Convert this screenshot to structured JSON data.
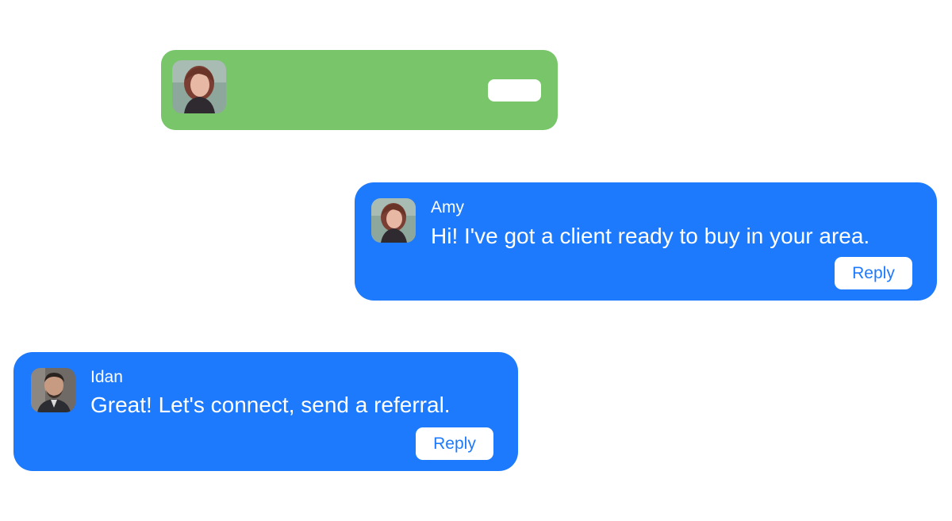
{
  "colors": {
    "green_card": "#79c66a",
    "blue_card": "#1e7afc",
    "reply_text": "#1e7afc",
    "text_on_card": "#ffffff"
  },
  "top_card": {
    "avatar_icon": "woman-avatar-photo"
  },
  "messages": [
    {
      "sender": "Amy",
      "text": "Hi! I've got a client ready to buy in your area.",
      "reply_label": "Reply",
      "avatar_icon": "woman-avatar-photo"
    },
    {
      "sender": "Idan",
      "text": "Great! Let's connect, send a referral.",
      "reply_label": "Reply",
      "avatar_icon": "man-avatar-photo"
    }
  ]
}
